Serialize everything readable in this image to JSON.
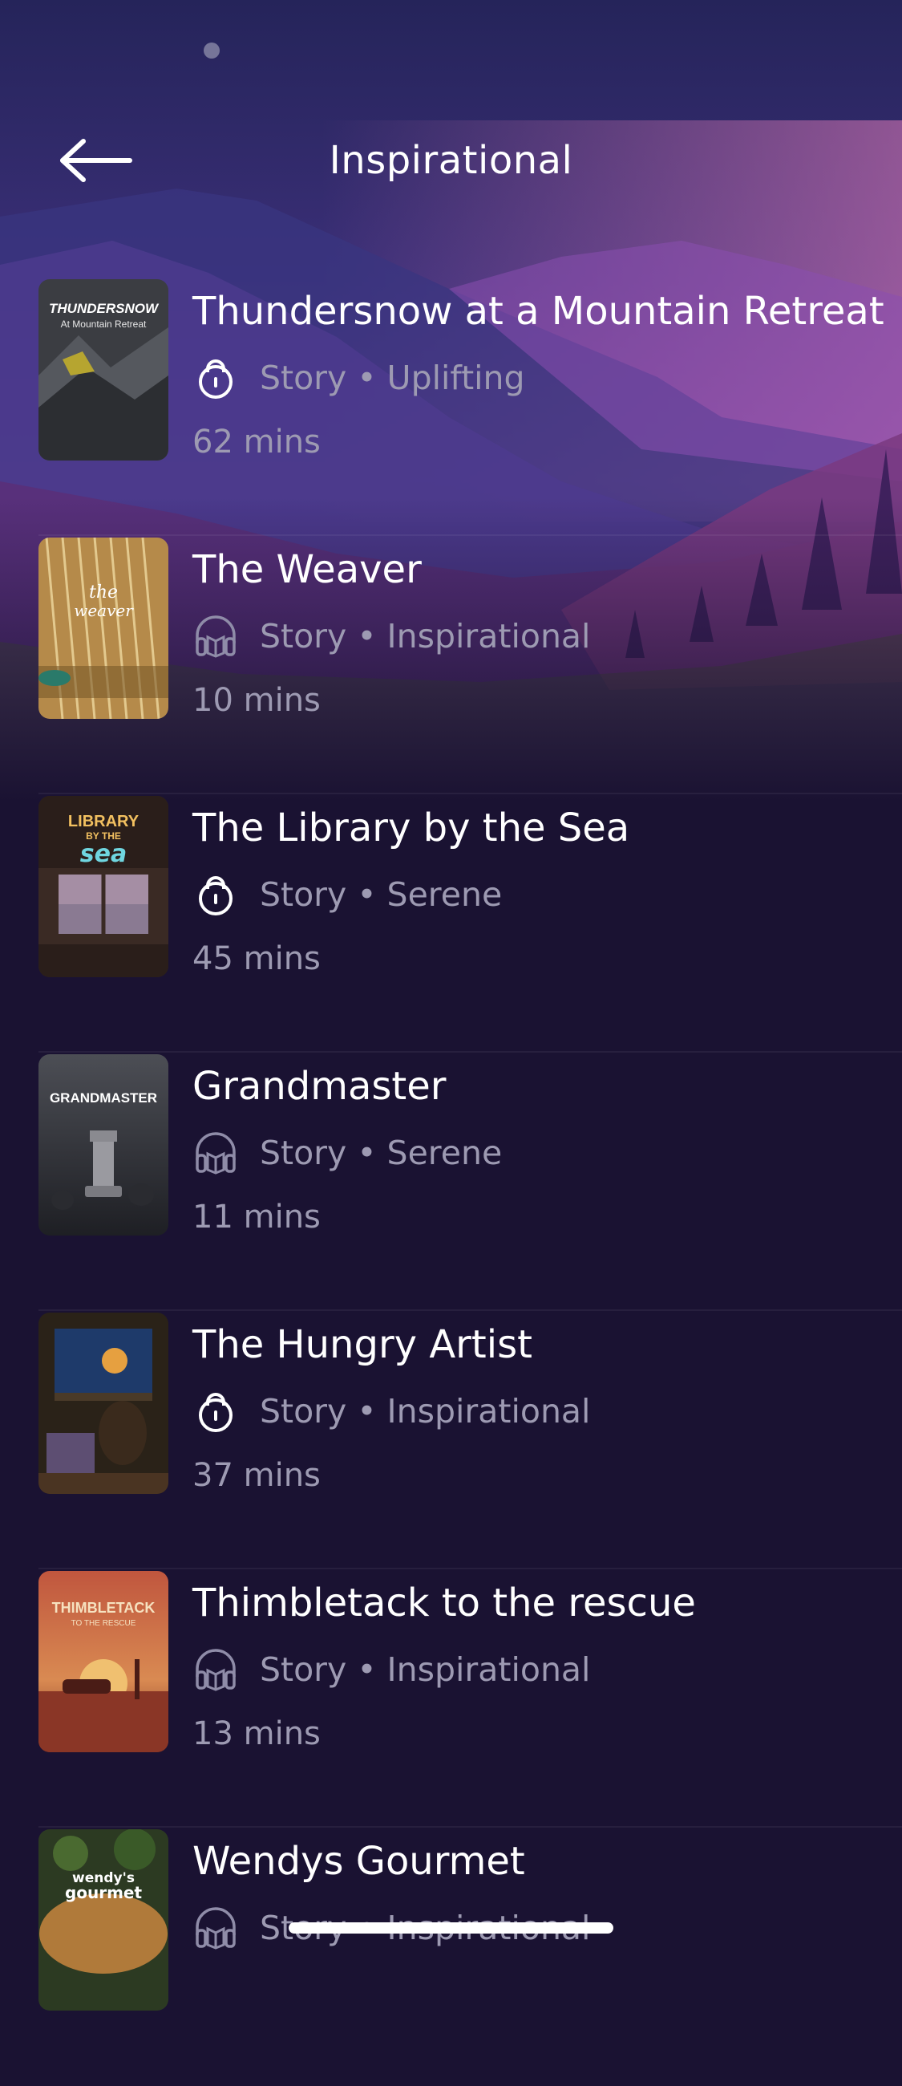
{
  "header": {
    "title": "Inspirational",
    "back_icon": "arrow-left-icon"
  },
  "items": [
    {
      "title": "Thundersnow at a Mountain Retreat",
      "access_icon": "lock-icon",
      "meta": "Story • Uplifting",
      "duration": "62 mins",
      "cover_text": [
        "THUNDERSNOW",
        "At Mountain Retreat"
      ]
    },
    {
      "title": "The Weaver",
      "access_icon": "headphones-icon",
      "meta": "Story • Inspirational",
      "duration": "10 mins",
      "cover_text": [
        "the",
        "weaver"
      ]
    },
    {
      "title": "The Library by the Sea",
      "access_icon": "lock-icon",
      "meta": "Story • Serene",
      "duration": "45 mins",
      "cover_text": [
        "LIBRARY",
        "BY THE",
        "sea"
      ]
    },
    {
      "title": "Grandmaster",
      "access_icon": "headphones-icon",
      "meta": "Story • Serene",
      "duration": "11 mins",
      "cover_text": [
        "GRANDMASTER"
      ]
    },
    {
      "title": "The Hungry Artist",
      "access_icon": "lock-icon",
      "meta": "Story • Inspirational",
      "duration": "37 mins",
      "cover_text": []
    },
    {
      "title": "Thimbletack to the rescue",
      "access_icon": "headphones-icon",
      "meta": "Story • Inspirational",
      "duration": "13 mins",
      "cover_text": [
        "THIMBLETACK",
        "TO THE RESCUE"
      ]
    },
    {
      "title": "Wendys Gourmet",
      "access_icon": "headphones-icon",
      "meta": "Story • Inspirational",
      "duration": "",
      "cover_text": [
        "wendy's",
        "gourmet"
      ]
    }
  ],
  "colors": {
    "background": "#1a1232",
    "muted_text": "#9d9ab2",
    "accent_purple": "#8a4fb0"
  }
}
